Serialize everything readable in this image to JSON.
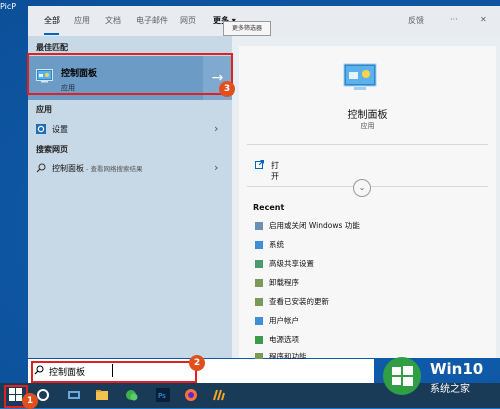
{
  "desktop": {
    "icon_label": "PicP"
  },
  "tabs": [
    {
      "label": "全部"
    },
    {
      "label": "应用"
    },
    {
      "label": "文档"
    },
    {
      "label": "电子邮件"
    },
    {
      "label": "网页"
    },
    {
      "label": "更多 ▾"
    }
  ],
  "tooltip": "更多筛选器",
  "header_right": {
    "feedback": "反馈",
    "more": "···",
    "close": "✕"
  },
  "left": {
    "best_match_label": "最佳匹配",
    "best_match": {
      "title": "控制面板",
      "subtitle": "应用"
    },
    "apps_label": "应用",
    "apps": [
      {
        "label": "设置"
      }
    ],
    "web_label": "搜索网页",
    "web": [
      {
        "label": "控制面板",
        "hint": " - 查看网络搜索结果"
      }
    ]
  },
  "preview": {
    "title": "控制面板",
    "subtitle": "应用",
    "open": "打开",
    "recent_label": "Recent",
    "recent": [
      {
        "label": "启用或关闭 Windows 功能"
      },
      {
        "label": "系统"
      },
      {
        "label": "高级共享设置"
      },
      {
        "label": "卸载程序"
      },
      {
        "label": "查看已安装的更新"
      },
      {
        "label": "用户帐户"
      },
      {
        "label": "电源选项"
      },
      {
        "label": "程序和功能"
      }
    ]
  },
  "search": {
    "query": "控制面板"
  },
  "badges": [
    "1",
    "2",
    "3"
  ],
  "watermark": {
    "line1": "Win10",
    "line2": "系统之家"
  },
  "colors": {
    "accent": "#0067c0",
    "highlight": "#e12121",
    "badge": "#e0501f"
  }
}
